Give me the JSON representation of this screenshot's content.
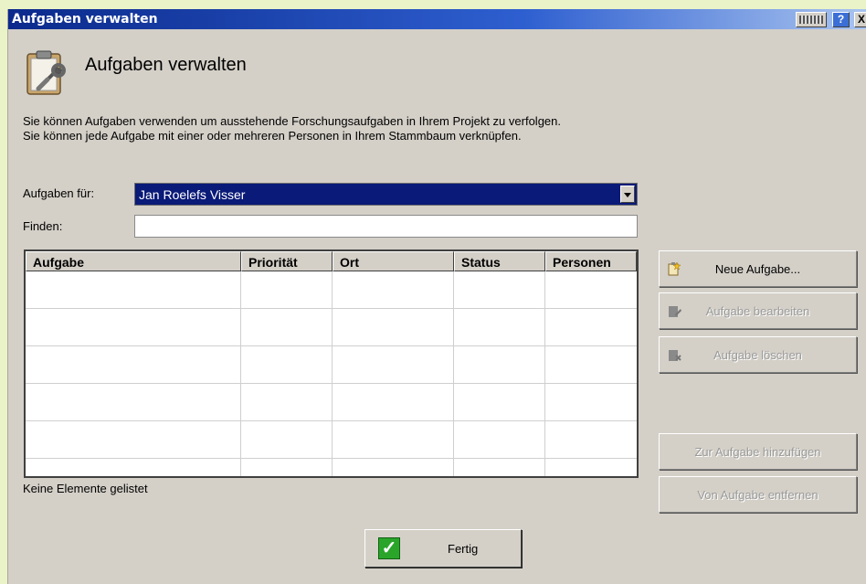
{
  "window": {
    "title": "Aufgaben verwalten",
    "help_label": "?",
    "close_label": "X"
  },
  "header": {
    "title": "Aufgaben verwalten",
    "icon": "clipboard-wrench-icon"
  },
  "description": {
    "line1": "Sie können Aufgaben verwenden um ausstehende Forschungsaufgaben in Ihrem Projekt zu verfolgen.",
    "line2": "Sie können jede Aufgabe mit einer oder mehreren Personen in Ihrem Stammbaum verknüpfen."
  },
  "filter": {
    "for_label": "Aufgaben für:",
    "for_value": "Jan Roelefs Visser",
    "find_label": "Finden:",
    "find_value": ""
  },
  "table": {
    "columns": [
      "Aufgabe",
      "Priorität",
      "Ort",
      "Status",
      "Personen"
    ],
    "rows": [],
    "empty_rows_shown": 6
  },
  "status_text": "Keine Elemente gelistet",
  "buttons": {
    "new_task": "Neue Aufgabe...",
    "edit_task": "Aufgabe bearbeiten",
    "delete_task": "Aufgabe löschen",
    "add_to_task": "Zur Aufgabe hinzufügen",
    "remove_from_task": "Von Aufgabe entfernen",
    "done": "Fertig"
  },
  "colors": {
    "titlebar": "#0b2a8c",
    "selection": "#0a1a78",
    "dialog_bg": "#d4d0c8",
    "done_check": "#2aa52a"
  }
}
